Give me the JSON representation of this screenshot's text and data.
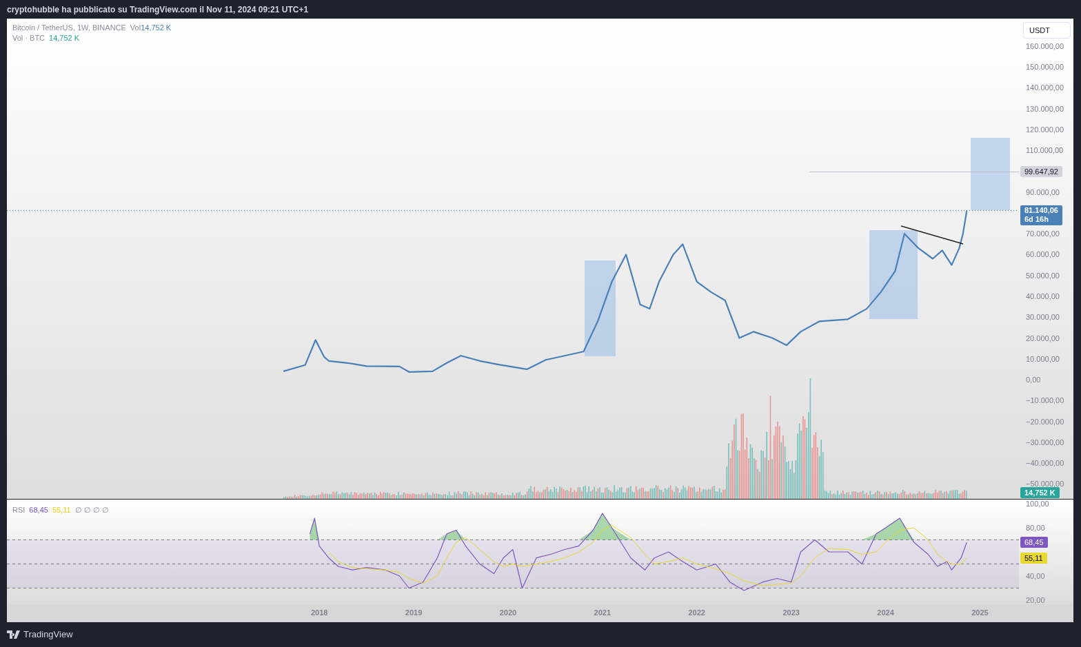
{
  "header": {
    "text": "cryptohubble ha pubblicato su TradingView.com il Nov 11, 2024 09:21 UTC+1"
  },
  "price_chart": {
    "legend": {
      "symbol": "Bitcoin / TetherUS, 1W, BINANCE",
      "volume_label": "Vol",
      "volume_value": "14,752 K"
    },
    "volume_legend": {
      "label": "Vol · BTC",
      "value": "14,752 K"
    },
    "currency_button": "USDT",
    "last_price": {
      "label": "81.140,06",
      "countdown": "6d 16h"
    },
    "volume": {
      "label": "14,752 K"
    },
    "chart_data": {
      "type": "line",
      "xlim": [
        2014.69,
        2025.99
      ],
      "ylim": [
        -57190,
        173223
      ],
      "x": [
        2017.62,
        2017.85,
        2017.96,
        2018.05,
        2018.1,
        2018.3,
        2018.5,
        2018.85,
        2018.95,
        2019.2,
        2019.35,
        2019.5,
        2019.7,
        2019.9,
        2020.2,
        2020.4,
        2020.6,
        2020.8,
        2020.95,
        2021.1,
        2021.25,
        2021.4,
        2021.5,
        2021.6,
        2021.75,
        2021.85,
        2022.0,
        2022.15,
        2022.3,
        2022.45,
        2022.6,
        2022.8,
        2022.95,
        2023.1,
        2023.3,
        2023.6,
        2023.8,
        2023.95,
        2024.1,
        2024.2,
        2024.35,
        2024.5,
        2024.6,
        2024.7,
        2024.78,
        2024.82,
        2024.86
      ],
      "series": [
        {
          "color": "#4a80b8",
          "values": [
            4000,
            7000,
            19000,
            11000,
            9000,
            8000,
            6500,
            6300,
            3700,
            4000,
            8000,
            11500,
            9000,
            7200,
            5000,
            9500,
            11500,
            13500,
            28000,
            47000,
            60000,
            36000,
            34000,
            47000,
            60000,
            65000,
            47000,
            42000,
            38000,
            20000,
            23000,
            20000,
            16500,
            23000,
            28000,
            29000,
            34000,
            42000,
            52000,
            70000,
            63000,
            58000,
            62000,
            55000,
            63000,
            70000,
            81140
          ]
        }
      ],
      "yticks": [
        {
          "value": 160000,
          "label": "160.000,00"
        },
        {
          "value": 150000,
          "label": "150.000,00"
        },
        {
          "value": 140000,
          "label": "140.000,00"
        },
        {
          "value": 130000,
          "label": "130.000,00"
        },
        {
          "value": 120000,
          "label": "120.000,00"
        },
        {
          "value": 110000,
          "label": "110.000,00"
        },
        {
          "value": 90000,
          "label": "90.000,00"
        },
        {
          "value": 70000,
          "label": "70.000,00"
        },
        {
          "value": 60000,
          "label": "60.000,00"
        },
        {
          "value": 50000,
          "label": "50.000,00"
        },
        {
          "value": 40000,
          "label": "40.000,00"
        },
        {
          "value": 30000,
          "label": "30.000,00"
        },
        {
          "value": 20000,
          "label": "20.000,00"
        },
        {
          "value": 10000,
          "label": "10.000,00"
        },
        {
          "value": 0,
          "label": "0,00"
        },
        {
          "value": -10000,
          "label": "−10.000,00"
        },
        {
          "value": -20000,
          "label": "−20.000,00"
        },
        {
          "value": -30000,
          "label": "−30.000,00"
        },
        {
          "value": -40000,
          "label": "−40.000,00"
        },
        {
          "value": -50000,
          "label": "−50.000,00"
        }
      ],
      "ref_lines": [
        {
          "axis": "y",
          "value": 99647.92,
          "label": "99.647,92"
        },
        {
          "axis": "y",
          "value": 81140
        }
      ]
    }
  },
  "rsi_chart": {
    "legend": {
      "name": "RSI",
      "value": "68,45",
      "ma_value": "55,11",
      "inputs": "∅ ∅ ∅ ∅"
    },
    "value_tags": [
      "68,45",
      "55,11"
    ],
    "chart_data": {
      "type": "line",
      "xlim": [
        2014.69,
        2025.99
      ],
      "ylim": [
        16.57,
        103.43
      ],
      "x": [
        2017.9,
        2017.95,
        2018.0,
        2018.1,
        2018.2,
        2018.35,
        2018.5,
        2018.7,
        2018.85,
        2018.95,
        2019.1,
        2019.25,
        2019.35,
        2019.45,
        2019.55,
        2019.7,
        2019.85,
        2019.95,
        2020.05,
        2020.15,
        2020.3,
        2020.45,
        2020.6,
        2020.75,
        2020.9,
        2021.0,
        2021.1,
        2021.3,
        2021.45,
        2021.55,
        2021.7,
        2021.85,
        2022.0,
        2022.2,
        2022.35,
        2022.5,
        2022.7,
        2022.85,
        2023.0,
        2023.1,
        2023.25,
        2023.4,
        2023.6,
        2023.75,
        2023.9,
        2024.0,
        2024.15,
        2024.3,
        2024.45,
        2024.55,
        2024.65,
        2024.7,
        2024.8,
        2024.86
      ],
      "series": [
        {
          "color": "#7e57c2",
          "values": [
            75,
            88,
            65,
            55,
            48,
            45,
            47,
            45,
            40,
            30,
            35,
            55,
            75,
            78,
            65,
            50,
            42,
            55,
            62,
            30,
            55,
            58,
            62,
            65,
            78,
            92,
            80,
            55,
            45,
            55,
            60,
            52,
            45,
            50,
            35,
            28,
            35,
            38,
            35,
            60,
            70,
            60,
            60,
            50,
            75,
            80,
            88,
            68,
            58,
            48,
            52,
            45,
            55,
            68
          ]
        },
        {
          "color": "#e8d832",
          "values": [
            null,
            null,
            null,
            60,
            52,
            47,
            46,
            45,
            43,
            38,
            34,
            40,
            55,
            68,
            72,
            62,
            52,
            48,
            50,
            48,
            50,
            52,
            55,
            60,
            68,
            78,
            82,
            72,
            58,
            50,
            52,
            55,
            50,
            46,
            42,
            36,
            32,
            33,
            34,
            40,
            55,
            63,
            62,
            58,
            60,
            68,
            78,
            80,
            70,
            58,
            52,
            50,
            50,
            55
          ]
        }
      ],
      "xticks": [
        {
          "value": 2018,
          "label": "2018"
        },
        {
          "value": 2019,
          "label": "2019"
        },
        {
          "value": 2020,
          "label": "2020"
        },
        {
          "value": 2021,
          "label": "2021"
        },
        {
          "value": 2022,
          "label": "2022"
        },
        {
          "value": 2023,
          "label": "2023"
        },
        {
          "value": 2024,
          "label": "2024"
        },
        {
          "value": 2025,
          "label": "2025"
        }
      ],
      "yticks": [
        {
          "value": 100,
          "label": "100,00"
        },
        {
          "value": 80,
          "label": "80,00"
        },
        {
          "value": 40,
          "label": "40,00"
        },
        {
          "value": 20,
          "label": "20,00"
        }
      ],
      "ref_lines": [
        {
          "axis": "y",
          "value": 70
        },
        {
          "axis": "y",
          "value": 50
        },
        {
          "axis": "y",
          "value": 30
        }
      ],
      "bands": [
        {
          "axis": "y",
          "from": 30,
          "to": 70
        }
      ]
    }
  },
  "footer": {
    "brand": "TradingView"
  }
}
